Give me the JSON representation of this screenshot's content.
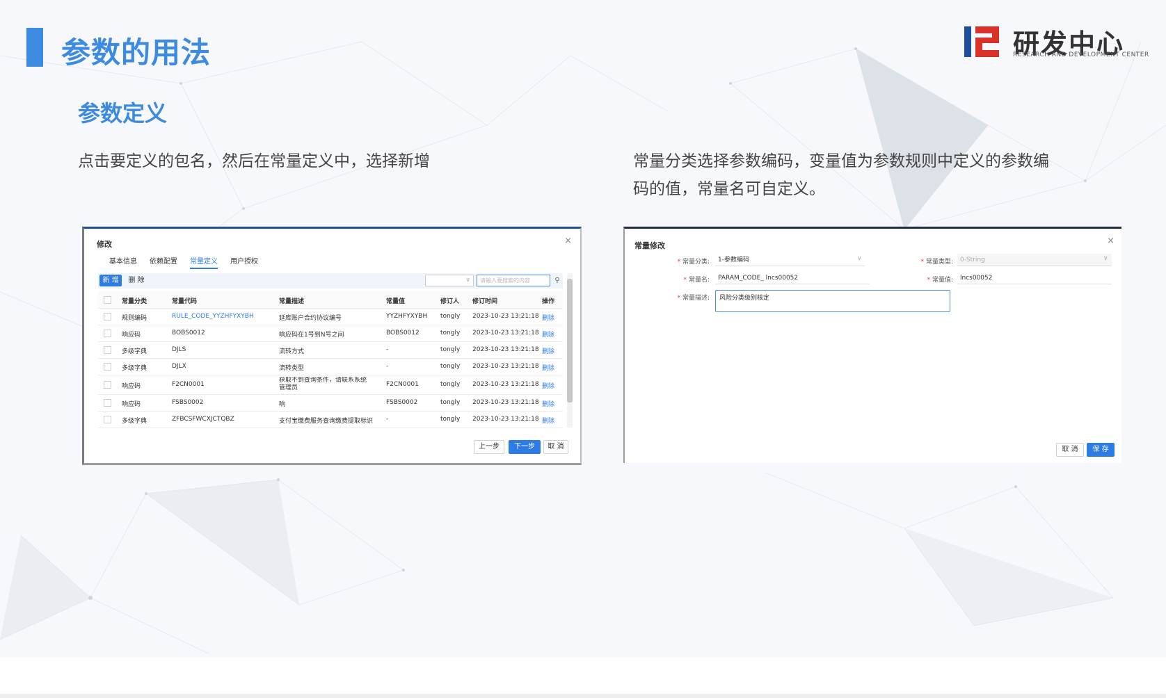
{
  "slide": {
    "title": "参数的用法",
    "section_title": "参数定义",
    "desc_left": "点击要定义的包名，然后在常量定义中，选择新增",
    "desc_right": "常量分类选择参数编码，变量值为参数规则中定义的参数编码的值，常量名可自定义。",
    "accent_color": "#3d8be0"
  },
  "logo": {
    "name": "研发中心",
    "subtitle": "RESEARCH AND DEVELOPMENT CENTER",
    "colors": [
      "#1f4e9a",
      "#d9322b"
    ]
  },
  "shot1": {
    "dialog_title": "修改",
    "close": "×",
    "tabs": [
      {
        "label": "基本信息",
        "active": false
      },
      {
        "label": "依赖配置",
        "active": false
      },
      {
        "label": "常量定义",
        "active": true
      },
      {
        "label": "用户授权",
        "active": false
      }
    ],
    "new_button": "新 增",
    "delete_button": "删 除",
    "select_arrow": "∨",
    "search_placeholder": "请输入要搜索的内容",
    "search_icon": "⚲",
    "columns": [
      "常量分类",
      "常量代码",
      "常量描述",
      "常量值",
      "修订人",
      "修订时间",
      "操作"
    ],
    "rows": [
      {
        "category": "规则编码",
        "code": "RULE_CODE_YYZHFYXYBH",
        "desc": "延库账户合约协议编号",
        "value": "YYZHFYXYBH",
        "user": "tongly",
        "time": "2023-10-23 13:21:18",
        "action": "删除"
      },
      {
        "category": "响应码",
        "code": "BOBS0012",
        "desc": "响应码在1号到N号之间",
        "value": "BOBS0012",
        "user": "tongly",
        "time": "2023-10-23 13:21:18",
        "action": "删除"
      },
      {
        "category": "多级字典",
        "code": "DJLS",
        "desc": "流转方式",
        "value": "-",
        "user": "tongly",
        "time": "2023-10-23 13:21:18",
        "action": "删除"
      },
      {
        "category": "多级字典",
        "code": "DJLX",
        "desc": "流转类型",
        "value": "-",
        "user": "tongly",
        "time": "2023-10-23 13:21:18",
        "action": "删除"
      },
      {
        "category": "响应码",
        "code": "F2CN0001",
        "desc": "获取不到查询条件，请联系系统管理员",
        "value": "F2CN0001",
        "user": "tongly",
        "time": "2023-10-23 13:21:18",
        "action": "删除"
      },
      {
        "category": "响应码",
        "code": "FSBS0002",
        "desc": "响",
        "value": "FSBS0002",
        "user": "tongly",
        "time": "2023-10-23 13:21:18",
        "action": "删除"
      },
      {
        "category": "多级字典",
        "code": "ZFBCSFWCXJCTQBZ",
        "desc": "支付宝缴费服务查询缴费提取标识",
        "value": "-",
        "user": "tongly",
        "time": "2023-10-23 13:21:18",
        "action": "删除"
      }
    ],
    "btn_prev": "上一步",
    "btn_next": "下一步",
    "btn_cancel": "取 消"
  },
  "shot2": {
    "dialog_title": "常量修改",
    "close": "×",
    "label_category": "常量分类:",
    "value_category": "1-参数编码",
    "label_type": "常量类型:",
    "value_type": "0-String",
    "label_name": "常量名:",
    "value_name": "PARAM_CODE_   lncs00052",
    "label_value": "常量值:",
    "value_value": "lncs00052",
    "label_desc": "常量描述:",
    "value_desc": "风险分类级别核定",
    "required_mark": "*",
    "arrow": "∨",
    "btn_cancel": "取 消",
    "btn_save": "保 存"
  }
}
